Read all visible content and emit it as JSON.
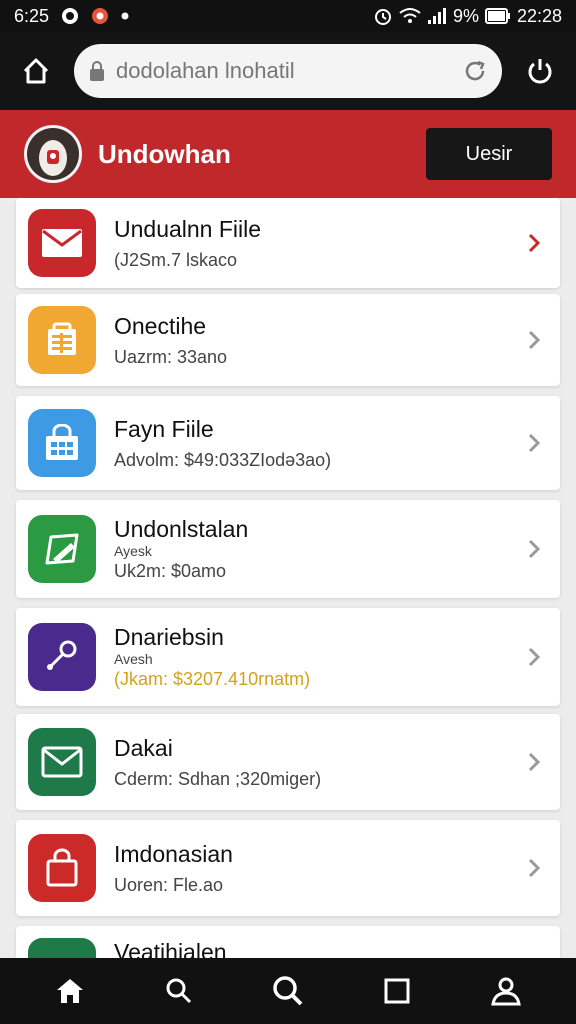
{
  "status": {
    "time_left": "6:25",
    "battery": "9%",
    "time_right": "22:28"
  },
  "browser": {
    "url": "dodolahan lnohatil"
  },
  "header": {
    "title": "Undowhan",
    "button_label": "Uesir"
  },
  "items": [
    {
      "title": "Undualnn Fiile",
      "label": "",
      "subtitle": "(J2Sm.7 lskaco",
      "color": "#c8282c",
      "icon": "mail-icon",
      "sub_color": "#444444",
      "chev_color": "#c8282c"
    },
    {
      "title": "Onectihe",
      "label": "",
      "subtitle": "Uazrm: 33ano",
      "color": "#f0a833",
      "icon": "calendar-icon",
      "sub_color": "#444444",
      "chev_color": "#9a9a9a"
    },
    {
      "title": "Fayn Fiile",
      "label": "",
      "subtitle": "Advolm: $49:033ZIodə3ao)",
      "color": "#3e9be3",
      "icon": "basket-icon",
      "sub_color": "#444444",
      "chev_color": "#9a9a9a"
    },
    {
      "title": "Undonlstalan",
      "label": "Ayesk",
      "subtitle": "Uk2m: $0amo",
      "color": "#2b9a43",
      "icon": "edit-icon",
      "sub_color": "#444444",
      "chev_color": "#9a9a9a"
    },
    {
      "title": "Dnariebsin",
      "label": "Avesh",
      "subtitle": "(Jkam: $3207.410rnatm)",
      "color": "#4a2a8c",
      "icon": "key-icon",
      "sub_color": "#d4a21a",
      "chev_color": "#9a9a9a"
    },
    {
      "title": "Dakai",
      "label": "",
      "subtitle": "Cderm: Sdhan ;320miger)",
      "color": "#1e7a48",
      "icon": "envelope-icon",
      "sub_color": "#444444",
      "chev_color": "#9a9a9a"
    },
    {
      "title": "Imdonasian",
      "label": "",
      "subtitle": "Uoren: Fle.ao",
      "color": "#cc2a28",
      "icon": "bag-icon",
      "sub_color": "#444444",
      "chev_color": "#9a9a9a"
    },
    {
      "title": "Veatihialen",
      "label": "",
      "subtitle": "",
      "color": "#1e7a48",
      "icon": "folder-icon",
      "sub_color": "#444444",
      "chev_color": "#9a9a9a"
    }
  ],
  "nav": [
    "home-icon",
    "search-icon",
    "magnifier-icon",
    "square-icon",
    "profile-icon"
  ]
}
